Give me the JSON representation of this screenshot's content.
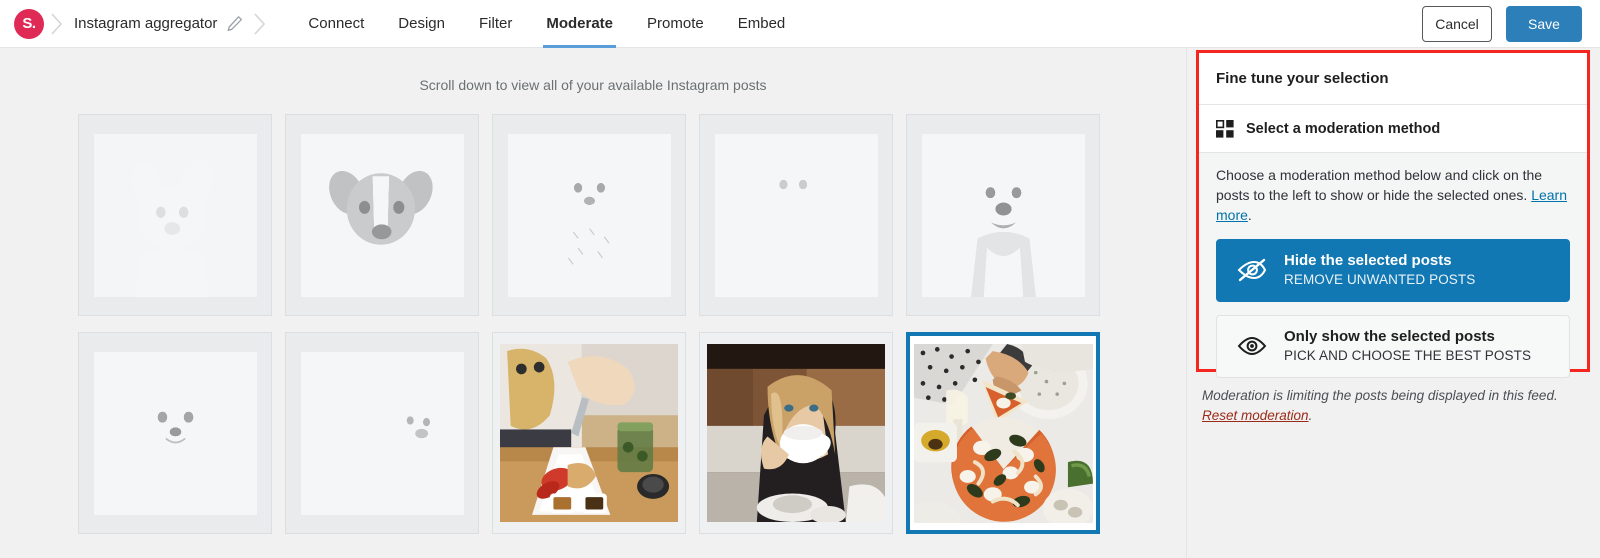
{
  "header": {
    "logo_text": "S.",
    "breadcrumb_title": "Instagram aggregator",
    "edit_icon": "pencil-icon",
    "tabs": [
      {
        "label": "Connect",
        "active": false
      },
      {
        "label": "Design",
        "active": false
      },
      {
        "label": "Filter",
        "active": false
      },
      {
        "label": "Moderate",
        "active": true
      },
      {
        "label": "Promote",
        "active": false
      },
      {
        "label": "Embed",
        "active": false
      }
    ],
    "cancel_label": "Cancel",
    "save_label": "Save"
  },
  "main": {
    "scroll_hint": "Scroll down to view all of your available Instagram posts",
    "posts": [
      {
        "name": "french-bulldog-with-chain",
        "state": "hidden"
      },
      {
        "name": "jack-russell-portrait",
        "state": "hidden"
      },
      {
        "name": "shih-tzu-in-shirt",
        "state": "hidden"
      },
      {
        "name": "kitten-reaching-up",
        "state": "hidden"
      },
      {
        "name": "schnauzer-smiling",
        "state": "hidden"
      },
      {
        "name": "corgi-puppy",
        "state": "hidden"
      },
      {
        "name": "bulldog-in-hoodie",
        "state": "hidden"
      },
      {
        "name": "brunch-plate",
        "state": "shown"
      },
      {
        "name": "woman-drinking-coffee",
        "state": "shown"
      },
      {
        "name": "pizza-being-served",
        "state": "selected"
      }
    ]
  },
  "sidebar": {
    "panel_title": "Fine tune your selection",
    "section_icon": "grid-squares-icon",
    "section_title": "Select a moderation method",
    "description_prefix": "Choose a moderation method below and click on the posts to the left to show or hide the selected ones. ",
    "learn_more_label": "Learn more",
    "description_suffix": ".",
    "methods": [
      {
        "icon": "eye-slash-icon",
        "title": "Hide the selected posts",
        "subtitle": "REMOVE UNWANTED POSTS",
        "variant": "primary"
      },
      {
        "icon": "eye-icon",
        "title": "Only show the selected posts",
        "subtitle": "PICK AND CHOOSE THE BEST POSTS",
        "variant": "secondary"
      }
    ],
    "footnote_text": "Moderation is limiting the posts being displayed in this feed. ",
    "reset_label": "Reset moderation",
    "footnote_suffix": "."
  },
  "colors": {
    "brand_pink": "#e02a56",
    "primary_blue": "#1278b3",
    "save_blue": "#2d7fba",
    "tab_underline": "#5b9dd9",
    "highlight_red": "#f5251f",
    "link_blue": "#0073aa",
    "reset_link": "#9b2b19",
    "page_bg": "#f1f1f1"
  }
}
